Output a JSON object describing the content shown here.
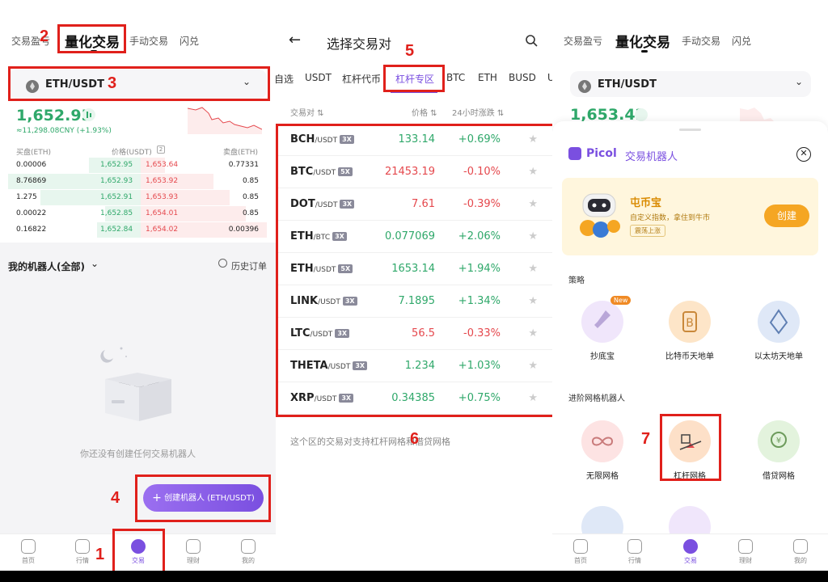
{
  "panel1": {
    "tabs": [
      "交易盈亏",
      "量化交易",
      "手动交易",
      "闪兑"
    ],
    "pair": "ETH/USDT",
    "price": "1,652.95",
    "cny": "≈11,298.08CNY (+1.93%)",
    "ob_headers": {
      "buy": "买盘(ETH)",
      "price": "价格(USDT)",
      "sell": "卖盘(ETH)"
    },
    "orderbook": [
      {
        "buy_qty": "0.00006",
        "buy_price": "1,652.95",
        "sell_price": "1,653.64",
        "sell_qty": "0.77331"
      },
      {
        "buy_qty": "8.76869",
        "buy_price": "1,652.93",
        "sell_price": "1,653.92",
        "sell_qty": "0.85"
      },
      {
        "buy_qty": "1.275",
        "buy_price": "1,652.91",
        "sell_price": "1,653.93",
        "sell_qty": "0.85"
      },
      {
        "buy_qty": "0.00022",
        "buy_price": "1,652.85",
        "sell_price": "1,654.01",
        "sell_qty": "0.85"
      },
      {
        "buy_qty": "0.16822",
        "buy_price": "1,652.84",
        "sell_price": "1,654.02",
        "sell_qty": "0.00396"
      }
    ],
    "my_bots": "我的机器人(全部)",
    "history": "历史订单",
    "empty_text": "你还没有创建任何交易机器人",
    "create_btn": "创建机器人 (ETH/USDT)"
  },
  "nav": [
    "首页",
    "行情",
    "交易",
    "理财",
    "我的"
  ],
  "panel2": {
    "title": "选择交易对",
    "tabs": [
      "自选",
      "USDT",
      "杠杆代币",
      "杠杆专区",
      "BTC",
      "ETH",
      "BUSD"
    ],
    "col_pair": "交易对",
    "col_price": "价格",
    "col_change": "24小时涨跌",
    "rows": [
      {
        "base": "BCH",
        "quote": "/USDT",
        "lev": "3X",
        "price": "133.14",
        "change": "+0.69%",
        "up": true
      },
      {
        "base": "BTC",
        "quote": "/USDT",
        "lev": "5X",
        "price": "21453.19",
        "change": "-0.10%",
        "up": false
      },
      {
        "base": "DOT",
        "quote": "/USDT",
        "lev": "3X",
        "price": "7.61",
        "change": "-0.39%",
        "up": false
      },
      {
        "base": "ETH",
        "quote": "/BTC",
        "lev": "3X",
        "price": "0.077069",
        "change": "+2.06%",
        "up": true
      },
      {
        "base": "ETH",
        "quote": "/USDT",
        "lev": "5X",
        "price": "1653.14",
        "change": "+1.94%",
        "up": true
      },
      {
        "base": "LINK",
        "quote": "/USDT",
        "lev": "3X",
        "price": "7.1895",
        "change": "+1.34%",
        "up": true
      },
      {
        "base": "LTC",
        "quote": "/USDT",
        "lev": "3X",
        "price": "56.5",
        "change": "-0.33%",
        "up": false
      },
      {
        "base": "THETA",
        "quote": "/USDT",
        "lev": "3X",
        "price": "1.234",
        "change": "+1.03%",
        "up": true
      },
      {
        "base": "XRP",
        "quote": "/USDT",
        "lev": "3X",
        "price": "0.34385",
        "change": "+0.75%",
        "up": true
      }
    ],
    "footer": "这个区的交易对支持杠杆网格和借贷网格"
  },
  "panel3": {
    "tabs": [
      "交易盈亏",
      "量化交易",
      "手动交易",
      "闪兑"
    ],
    "pair": "ETH/USDT",
    "price": "1,653.42",
    "brand": "Picol",
    "sheet_title": "交易机器人",
    "promo_title": "屯币宝",
    "promo_sub": "自定义指数，拿住到牛市",
    "promo_tag": "震荡上涨",
    "promo_btn": "创建",
    "section1": "策略",
    "strategies": [
      "抄底宝",
      "比特币天地单",
      "以太坊天地单"
    ],
    "new_badge": "New",
    "section2": "进阶网格机器人",
    "grids": [
      "无限网格",
      "杠杆网格",
      "借贷网格"
    ]
  },
  "markers": [
    "1",
    "2",
    "3",
    "4",
    "5",
    "6",
    "7"
  ],
  "colors": {
    "accent": "#7a4fe0",
    "up": "#2fa86a",
    "down": "#e5484d",
    "annotation": "#e0201b"
  }
}
